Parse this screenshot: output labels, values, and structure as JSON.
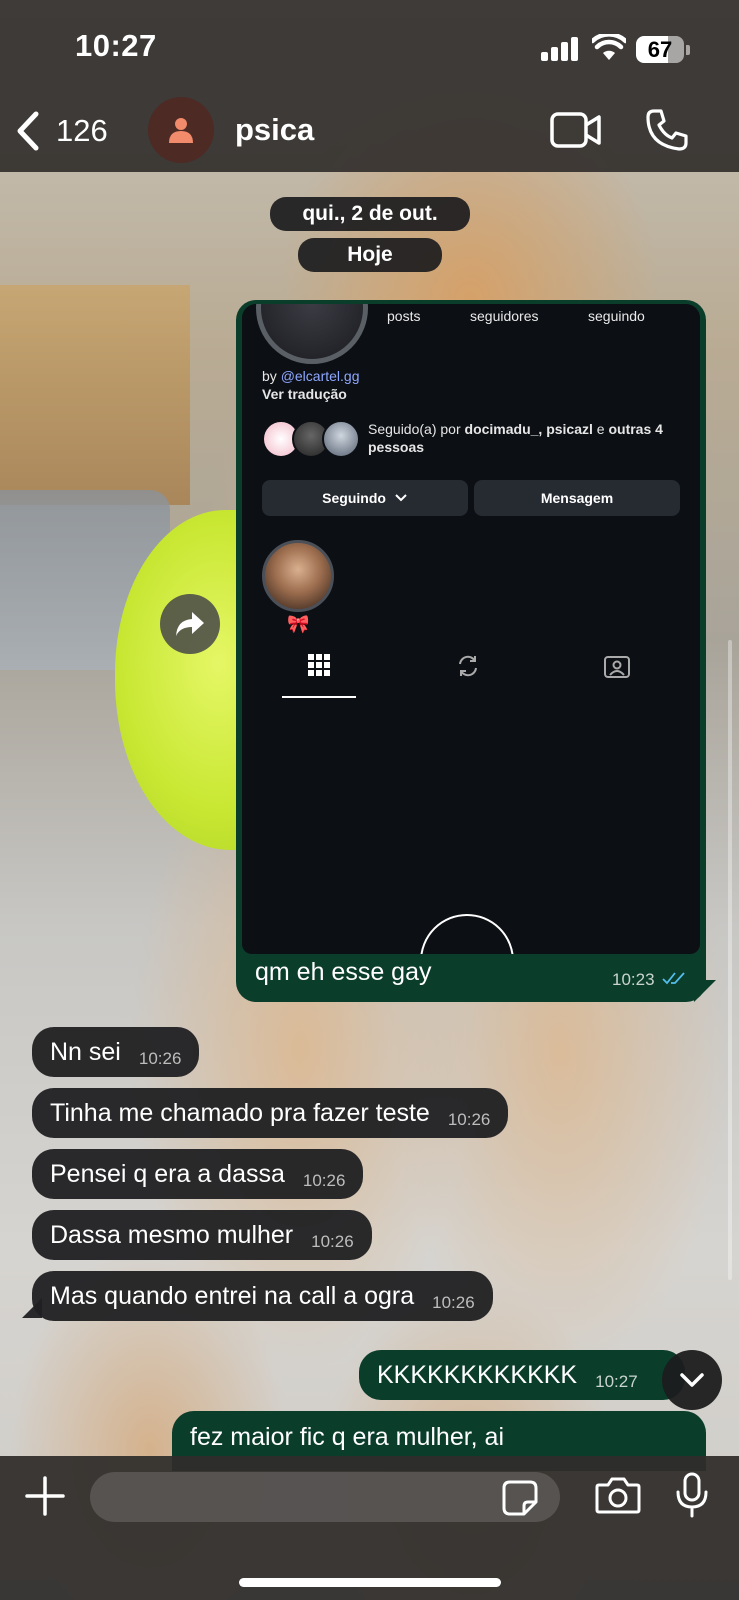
{
  "status_bar": {
    "time": "10:27",
    "battery": "67",
    "battery_level": 0.67
  },
  "header": {
    "back_count": "126",
    "contact_name": "psica"
  },
  "dates": {
    "previous": "qui., 2 de out.",
    "today": "Hoje"
  },
  "media_message": {
    "caption": "qm eh esse gay",
    "time": "10:23",
    "screenshot": {
      "stats": [
        "posts",
        "seguidores",
        "seguindo"
      ],
      "by_prefix": "by",
      "handle": "@elcartel.gg",
      "translate": "Ver tradução",
      "followed_prefix": "Seguido(a) por",
      "followed_names": "docimadu_, psicazl",
      "followed_and": "e",
      "followed_rest": "outras 4 pessoas",
      "following_button": "Seguindo",
      "message_button": "Mensagem",
      "highlight_emoji": "🎀"
    }
  },
  "messages": [
    {
      "text": "Nn sei",
      "time": "10:26",
      "dir": "in"
    },
    {
      "text": "Tinha me chamado pra fazer teste",
      "time": "10:26",
      "dir": "in"
    },
    {
      "text": "Pensei q era a dassa",
      "time": "10:26",
      "dir": "in"
    },
    {
      "text": "Dassa mesmo mulher",
      "time": "10:26",
      "dir": "in"
    },
    {
      "text": "Mas quando entrei na call a ogra",
      "time": "10:26",
      "dir": "in"
    },
    {
      "text": "KKKKKKKKKKKK",
      "time": "10:27",
      "dir": "out"
    },
    {
      "text": "fez maior fic q era mulher, ai",
      "time": "",
      "dir": "out"
    }
  ],
  "icons": [
    "back-chevron-icon",
    "person-icon",
    "video-camera-icon",
    "phone-icon",
    "forward-icon",
    "chevron-down-icon",
    "plus-icon",
    "sticker-icon",
    "camera-icon",
    "microphone-icon"
  ],
  "colors": {
    "outgoing_bubble": "#0b3d2b",
    "incoming_bubble": "#202022",
    "read_ticks": "#53bdeb",
    "avatar_bg": "#4d2a24",
    "avatar_icon": "#f28b6c"
  }
}
